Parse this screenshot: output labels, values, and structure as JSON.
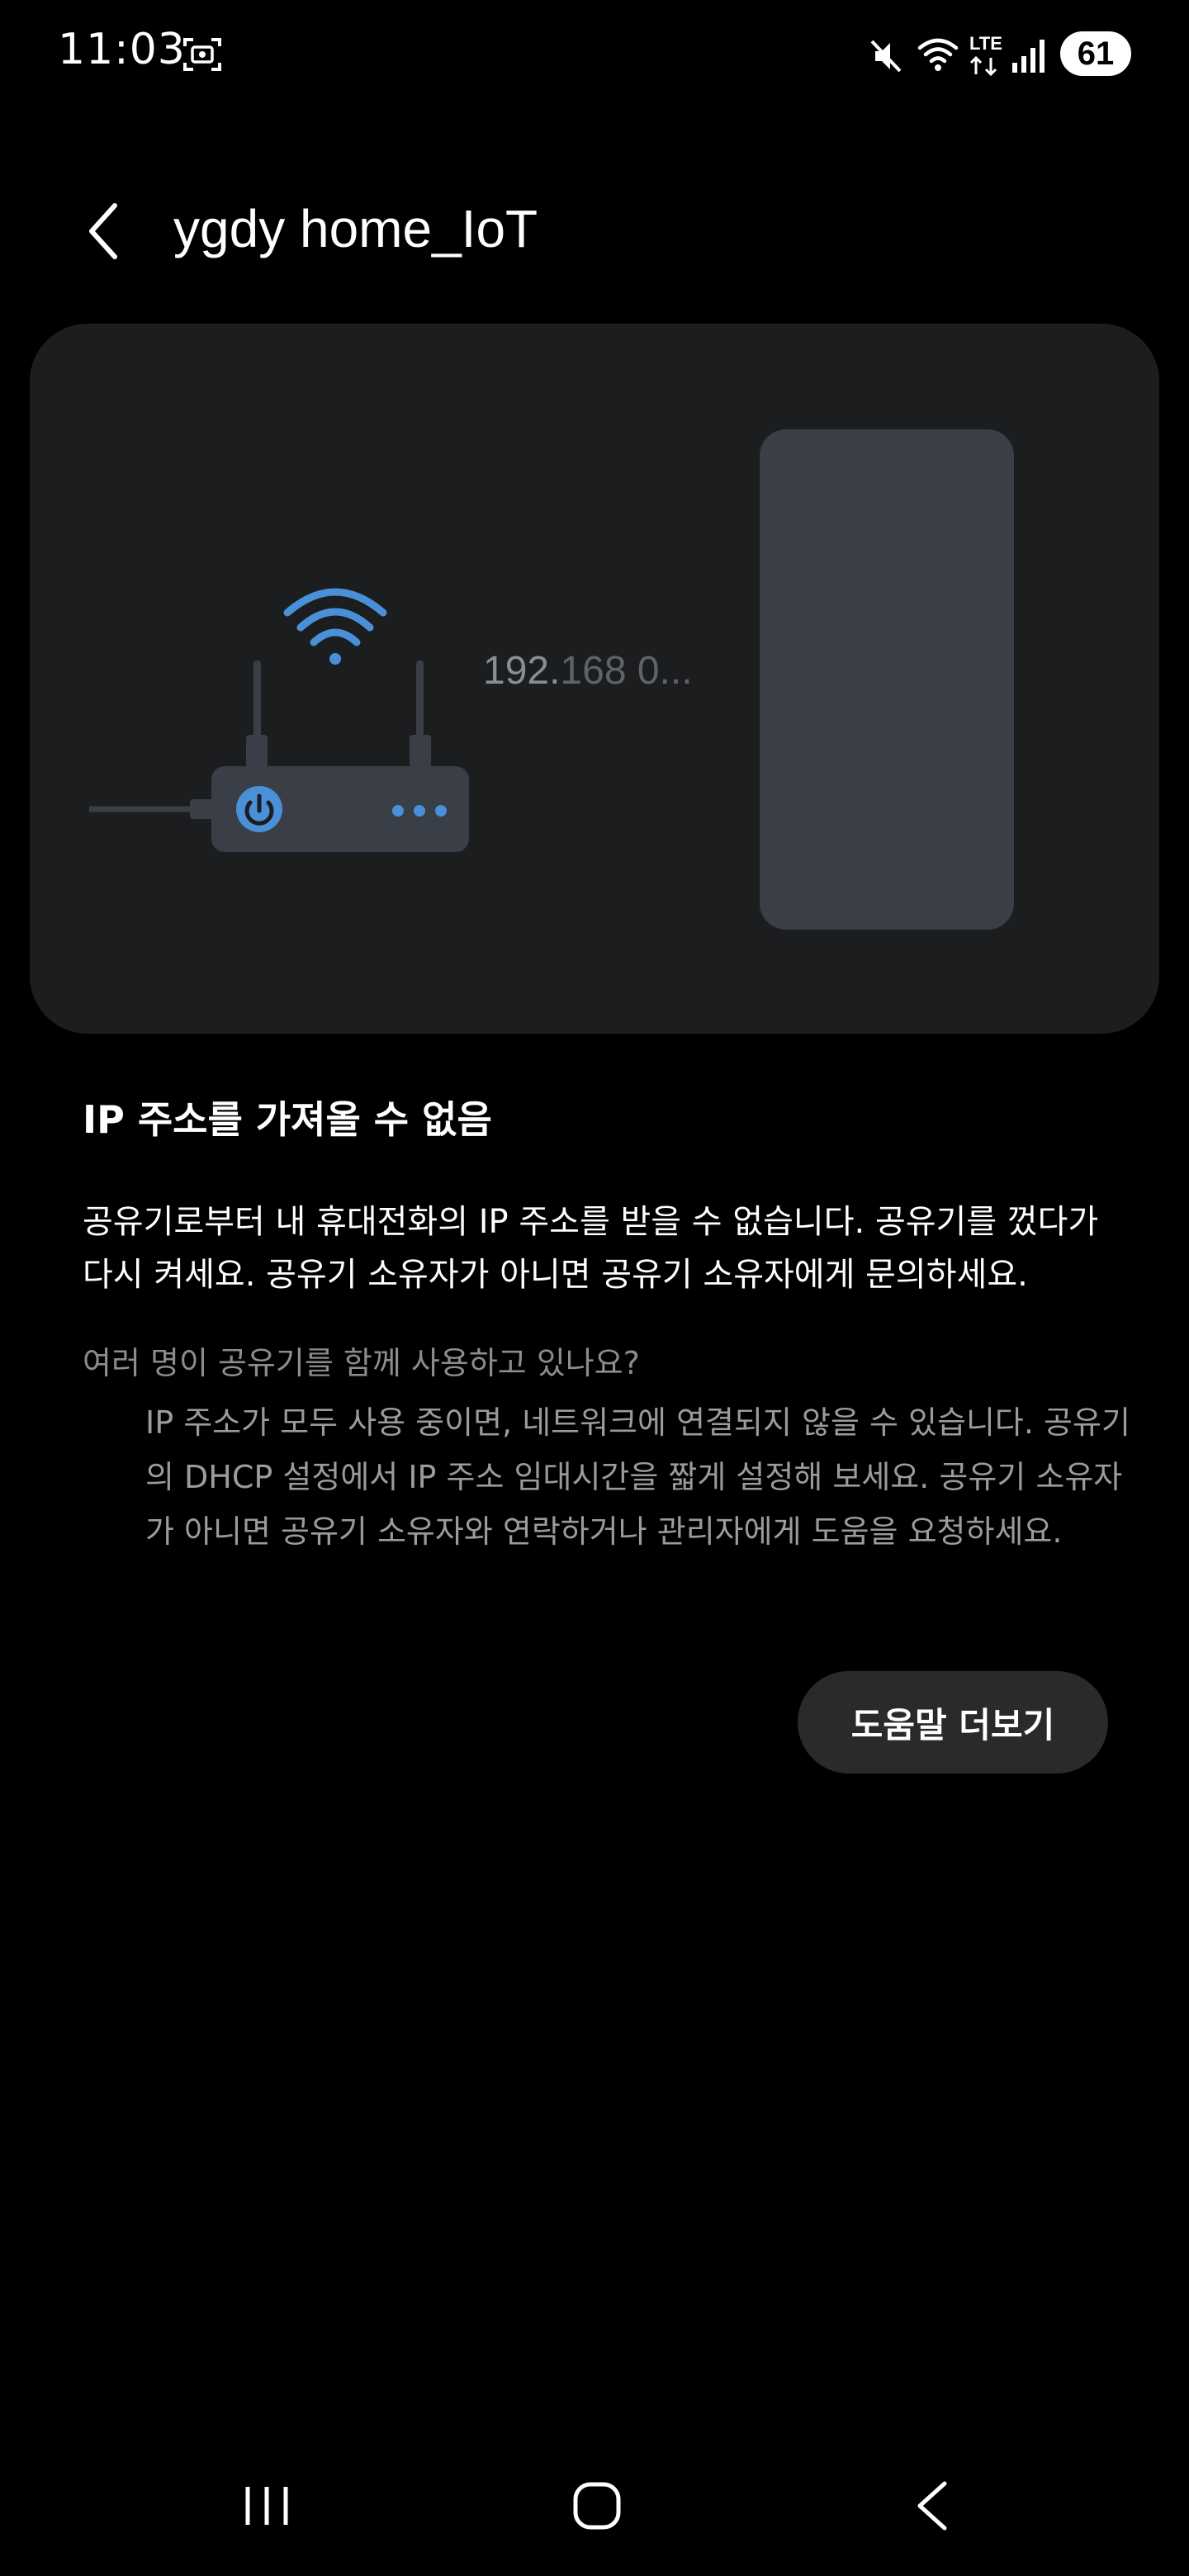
{
  "status_bar": {
    "time": "11:03",
    "battery": "61",
    "network_label": "LTE",
    "icons": [
      "screenshot-icon",
      "mute-icon",
      "wifi-icon",
      "lte-icon",
      "signal-icon",
      "battery-icon"
    ]
  },
  "header": {
    "title": "ygdy home_IoT",
    "back_icon": "chevron-left-icon"
  },
  "illustration": {
    "ip_bold": "192.",
    "ip_rest": "168 0...",
    "accent_color": "#4a90d9"
  },
  "content": {
    "error_title": "IP 주소를 가져올 수 없음",
    "error_body": "공유기로부터 내 휴대전화의 IP 주소를 받을 수 없습니다. 공유기를 껐다가 다시 켜세요. 공유기 소유자가 아니면 공유기 소유자에게 문의하세요.",
    "question": "여러 명이 공유기를 함께 사용하고 있나요?",
    "tips": "IP 주소가 모두 사용 중이면, 네트워크에 연결되지 않을 수 있습니다. 공유기의 DHCP 설정에서 IP 주소 임대시간을 짧게 설정해 보세요. 공유기 소유자가 아니면 공유기 소유자와 연락하거나 관리자에게 도움을 요청하세요.",
    "help_button": "도움말 더보기"
  },
  "nav_bar": {
    "icons": [
      "recents-icon",
      "home-icon",
      "back-icon"
    ]
  }
}
